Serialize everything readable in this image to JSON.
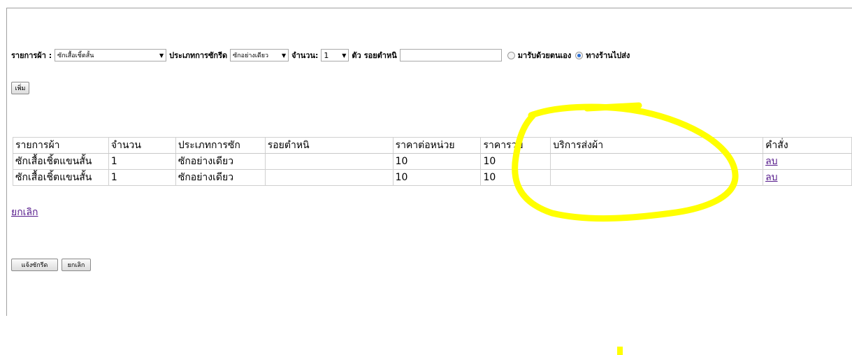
{
  "form": {
    "item_label": "รายการผ้า :",
    "item_select": "ซักเสื้อเชิ้ตสั้น",
    "wash_type_label": "ประเภทการซักรีด",
    "wash_type_select": "ซักอย่างเดียว",
    "qty_label": "จำนวน:",
    "qty_select": "1",
    "unit_label": "ตัว",
    "stain_label": "รอยตำหนิ",
    "stain_value": "",
    "pickup_self": "มารับด้วยตนเอง",
    "shop_delivery": "ทางร้านไปส่ง",
    "add_button": "เพิ่ม"
  },
  "table": {
    "headers": [
      "รายการผ้า",
      "จำนวน",
      "ประเภทการซัก",
      "รอยตำหนิ",
      "ราคาต่อหน่วย",
      "ราคารวม",
      "บริการส่งผ้า",
      "คำสั่ง"
    ],
    "rows": [
      {
        "item": "ซักเสื้อเชิ้ตแขนสั้น",
        "qty": "1",
        "type": "ซักอย่างเดียว",
        "stain": "",
        "unit_price": "10",
        "total": "10",
        "delivery": "",
        "action": "ลบ"
      },
      {
        "item": "ซักเสื้อเชิ้ตแขนสั้น",
        "qty": "1",
        "type": "ซักอย่างเดียว",
        "stain": "",
        "unit_price": "10",
        "total": "10",
        "delivery": "",
        "action": "ลบ"
      }
    ]
  },
  "cancel_link": "ยกเลิก",
  "bottom_buttons": {
    "notify": "แจ้งซักรีด",
    "cancel": "ยกเลิก"
  },
  "annotation_color": "#ffff00"
}
